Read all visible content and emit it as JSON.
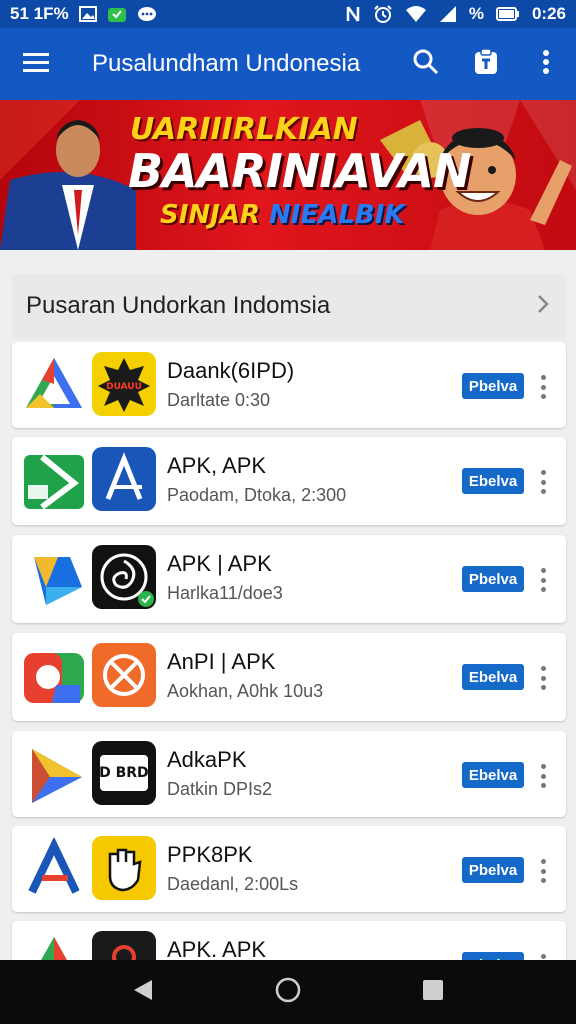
{
  "status_bar": {
    "left_text": "51 1F%",
    "time": "0:26",
    "battery": "%"
  },
  "app_bar": {
    "title": "Pusalundham Undonesia",
    "icons": [
      "menu-icon",
      "search-icon",
      "clipboard-icon",
      "more-vert-icon"
    ]
  },
  "banner": {
    "line1": "UARIIIRLKIAN",
    "line2": "BAARINIAVAN",
    "line3_a": "SINJAR",
    "line3_b": "NIEALBIK"
  },
  "section": {
    "title": "Pusaran Undorkan Indomsia"
  },
  "apps": [
    {
      "name": "Daank(6IPD)",
      "meta": "Darltate 0:30",
      "button": "Pbelva",
      "icon_label": "DUAUU"
    },
    {
      "name": "APK, APK",
      "meta": "Paodam, Dtoka, 2:300",
      "button": "Ebelva",
      "icon_label": ""
    },
    {
      "name": "APK | APK",
      "meta": "Harlka11/doe3",
      "button": "Pbelva",
      "icon_label": ""
    },
    {
      "name": "AnPI | APK",
      "meta": "Aokhan, A0hk 10u3",
      "button": "Ebelva",
      "icon_label": ""
    },
    {
      "name": "AdkaPK",
      "meta": "Datkin DPIs2",
      "button": "Ebelva",
      "icon_label": "DD BRDO"
    },
    {
      "name": "PPK8PK",
      "meta": "Daedanl, 2:00Ls",
      "button": "Pbelva",
      "icon_label": ""
    },
    {
      "name": "APK. APK",
      "meta": "",
      "button": "Ebelva",
      "icon_label": ""
    }
  ],
  "colors": {
    "app_bar": "#1458c4",
    "status_bar": "#0d4aa8",
    "button": "#1569c9",
    "banner_red": "#e0161c"
  }
}
